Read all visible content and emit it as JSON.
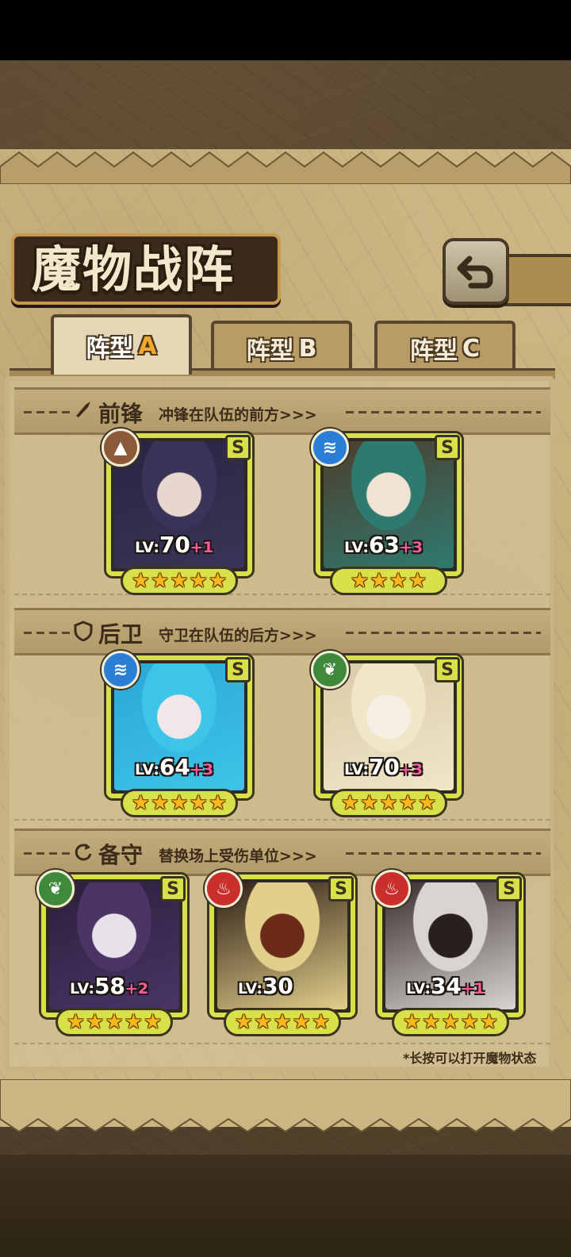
{
  "title": "魔物战阵",
  "back_icon": "return-arrow-icon",
  "tabs": [
    {
      "prefix": "阵型",
      "letter": "A",
      "active": true
    },
    {
      "prefix": "阵型",
      "letter": "B",
      "active": false
    },
    {
      "prefix": "阵型",
      "letter": "C",
      "active": false
    }
  ],
  "sections": {
    "front": {
      "title": "前锋",
      "subtitle": "冲锋在队伍的前方>>>",
      "icon": "sword-icon"
    },
    "rear": {
      "title": "后卫",
      "subtitle": "守卫在队伍的后方>>>",
      "icon": "shield-icon"
    },
    "reserve": {
      "title": "备守",
      "subtitle": "替换场上受伤单位>>>",
      "icon": "swap-icon"
    }
  },
  "units": {
    "front": [
      {
        "lv_prefix": "LV:",
        "level": "70",
        "bonus": "+1",
        "rarity": "S",
        "element": "earth",
        "element_icon": "mountain-icon",
        "element_color": "#8a5a3a",
        "stars": 5,
        "palette": [
          "#2a2442",
          "#3a3558",
          "#e8d7cc"
        ]
      },
      {
        "lv_prefix": "LV:",
        "level": "63",
        "bonus": "+3",
        "rarity": "S",
        "element": "water",
        "element_icon": "wave-icon",
        "element_color": "#2a7fd4",
        "stars": 4,
        "palette": [
          "#4d3d2d",
          "#2f7a6f",
          "#f1e3d4"
        ]
      }
    ],
    "rear": [
      {
        "lv_prefix": "LV:",
        "level": "64",
        "bonus": "+3",
        "rarity": "S",
        "element": "water",
        "element_icon": "wave-icon",
        "element_color": "#2a7fd4",
        "stars": 5,
        "palette": [
          "#2aa7d6",
          "#3ec4e8",
          "#f3e6e8"
        ]
      },
      {
        "lv_prefix": "LV:",
        "level": "70",
        "bonus": "+3",
        "rarity": "S",
        "element": "wood",
        "element_icon": "leaf-icon",
        "element_color": "#3e8a3a",
        "stars": 5,
        "palette": [
          "#d9cba8",
          "#f0e6c8",
          "#f6efe4"
        ]
      }
    ],
    "reserve": [
      {
        "lv_prefix": "LV:",
        "level": "58",
        "bonus": "+2",
        "rarity": "S",
        "element": "wood",
        "element_icon": "leaf-icon",
        "element_color": "#3e8a3a",
        "stars": 5,
        "palette": [
          "#2b1f3c",
          "#4a3566",
          "#e7e2ea"
        ]
      },
      {
        "lv_prefix": "LV:",
        "level": "30",
        "bonus": "",
        "rarity": "S",
        "element": "fire",
        "element_icon": "flame-icon",
        "element_color": "#c9302c",
        "stars": 5,
        "palette": [
          "#2f1f15",
          "#e2cf8c",
          "#6b2a1a"
        ]
      },
      {
        "lv_prefix": "LV:",
        "level": "34",
        "bonus": "+1",
        "rarity": "S",
        "element": "fire",
        "element_icon": "flame-icon",
        "element_color": "#c9302c",
        "stars": 5,
        "palette": [
          "#3a3030",
          "#d8d4d2",
          "#2a1f1f"
        ]
      }
    ]
  },
  "hint": "*长按可以打开魔物状态"
}
